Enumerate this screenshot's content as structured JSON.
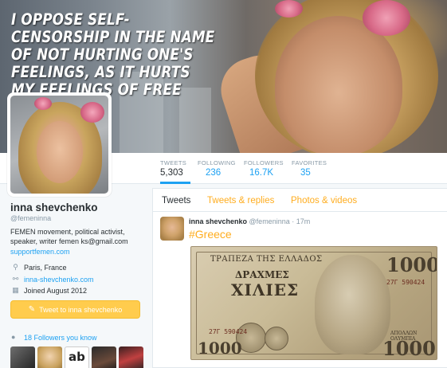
{
  "banner": {
    "quote": "I oppose self-censorship in the name of not hurting one's feelings, as it hurts my feelings of free speech."
  },
  "stats": [
    {
      "label": "TWEETS",
      "value": "5,303"
    },
    {
      "label": "FOLLOWING",
      "value": "236"
    },
    {
      "label": "FOLLOWERS",
      "value": "16.7K"
    },
    {
      "label": "FAVORITES",
      "value": "35"
    }
  ],
  "profile": {
    "name": "inna shevchenko",
    "handle": "@femeninna",
    "bio": "FEMEN movement, political activist, speaker, writer femen ks@gmail.com",
    "bio_link": "supportfemen.com",
    "location": "Paris, France",
    "website": "inna-shevchenko.com",
    "joined": "Joined August 2012",
    "tweet_to_label": "Tweet to inna shevchenko",
    "followers_you_know": "18 Followers you know"
  },
  "timeline": {
    "tabs": [
      "Tweets",
      "Tweets & replies",
      "Photos & videos"
    ],
    "tweet": {
      "name": "inna shevchenko",
      "handle": "@femeninna",
      "time": "· 17m",
      "hashtag": "#Greece"
    }
  },
  "banknote": {
    "bank": "ΤΡΑΠΕΖΑ ΤΗΣ ΕΛΛΑΔΟΣ",
    "drachmes": "ΔΡΑΧΜΕΣ",
    "xilies": "ΧΙΛΙΕΣ",
    "denomination": "1000",
    "serial_top": "27Γ 590424",
    "serial_bottom": "27Γ 590424",
    "caption": "ΑΠΟΛΛΩΝ ΟΛΥΜΠΙΑ"
  },
  "colors": {
    "accent": "#1da1f2",
    "highlight": "#ffad1f",
    "button": "#ffcc4d"
  }
}
